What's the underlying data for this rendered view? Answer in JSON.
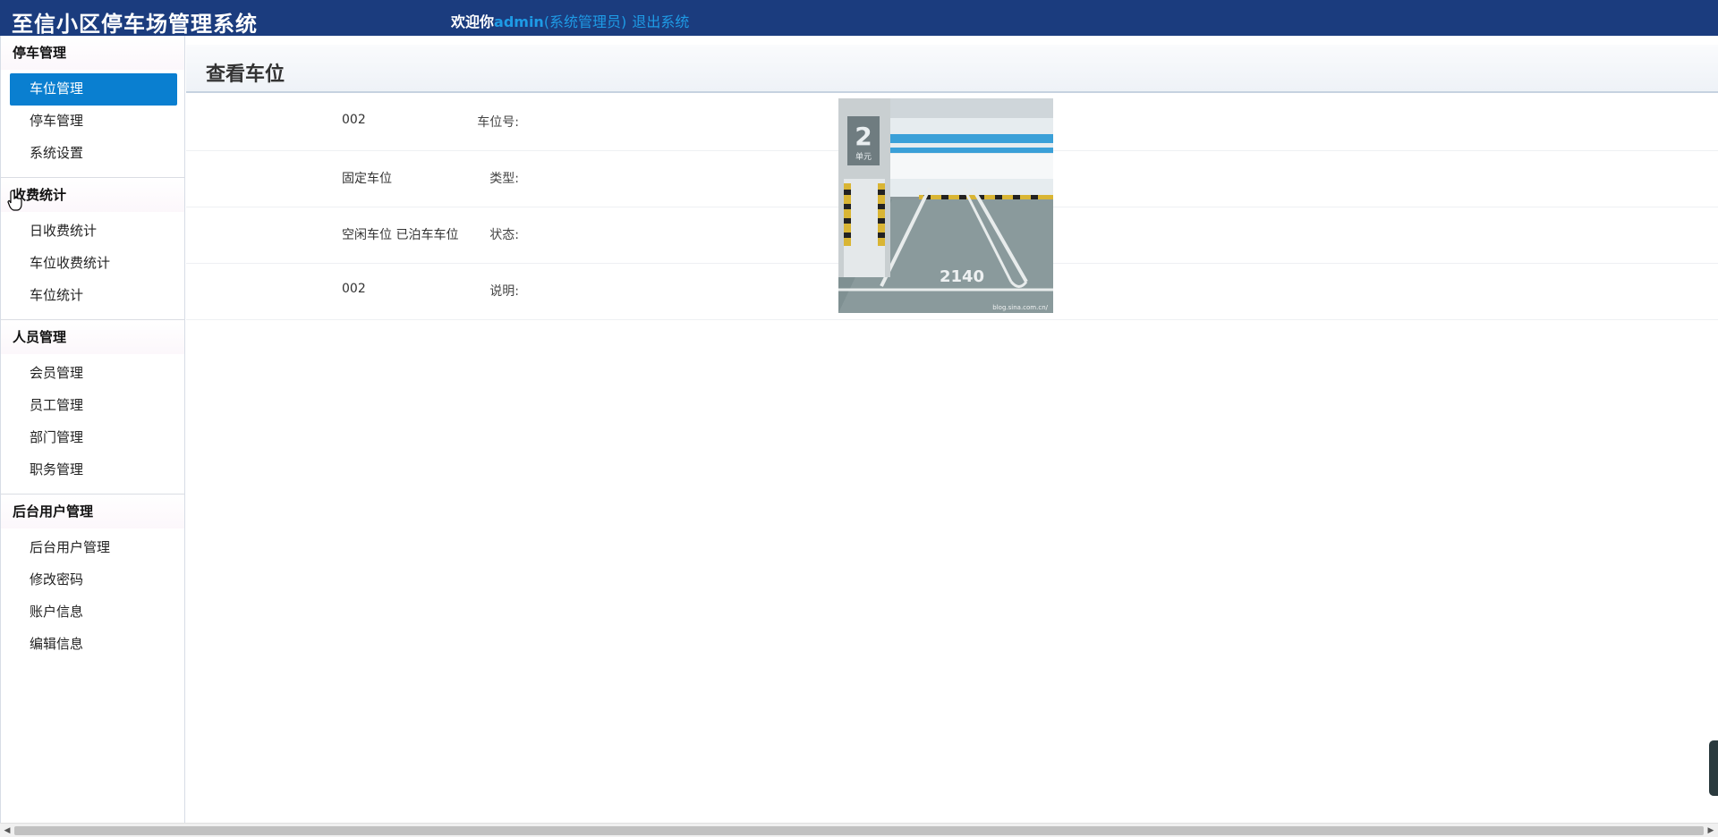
{
  "header": {
    "app_title": "至信小区停车场管理系统",
    "welcome_prefix": "欢迎你",
    "username": "admin",
    "role": "(系统管理员)",
    "logout": "退出系统",
    "bg_color": "#1b3c7e",
    "accent_color": "#1e9be6"
  },
  "sidebar": {
    "groups": [
      {
        "title": "停车管理",
        "items": [
          {
            "label": "车位管理",
            "active": true
          },
          {
            "label": "停车管理"
          },
          {
            "label": "系统设置"
          }
        ]
      },
      {
        "title": "收费统计",
        "items": [
          {
            "label": "日收费统计"
          },
          {
            "label": "车位收费统计"
          },
          {
            "label": "车位统计"
          }
        ]
      },
      {
        "title": "人员管理",
        "items": [
          {
            "label": "会员管理"
          },
          {
            "label": "员工管理"
          },
          {
            "label": "部门管理"
          },
          {
            "label": "职务管理"
          }
        ]
      },
      {
        "title": "后台用户管理",
        "items": [
          {
            "label": "后台用户管理"
          },
          {
            "label": "修改密码"
          },
          {
            "label": "账户信息"
          },
          {
            "label": "编辑信息"
          }
        ]
      }
    ]
  },
  "main": {
    "title": "查看车位",
    "fields": [
      {
        "label": "车位号:",
        "value": "002"
      },
      {
        "label": "类型:",
        "value": "固定车位"
      },
      {
        "label": "状态:",
        "value": "空闲车位 已泊车车位"
      },
      {
        "label": "说明:",
        "value": "002"
      }
    ],
    "photo": {
      "pillar_number": "2",
      "pillar_text": "单元",
      "space_number": "2140",
      "watermark": "blog.sina.com.cn/"
    }
  }
}
